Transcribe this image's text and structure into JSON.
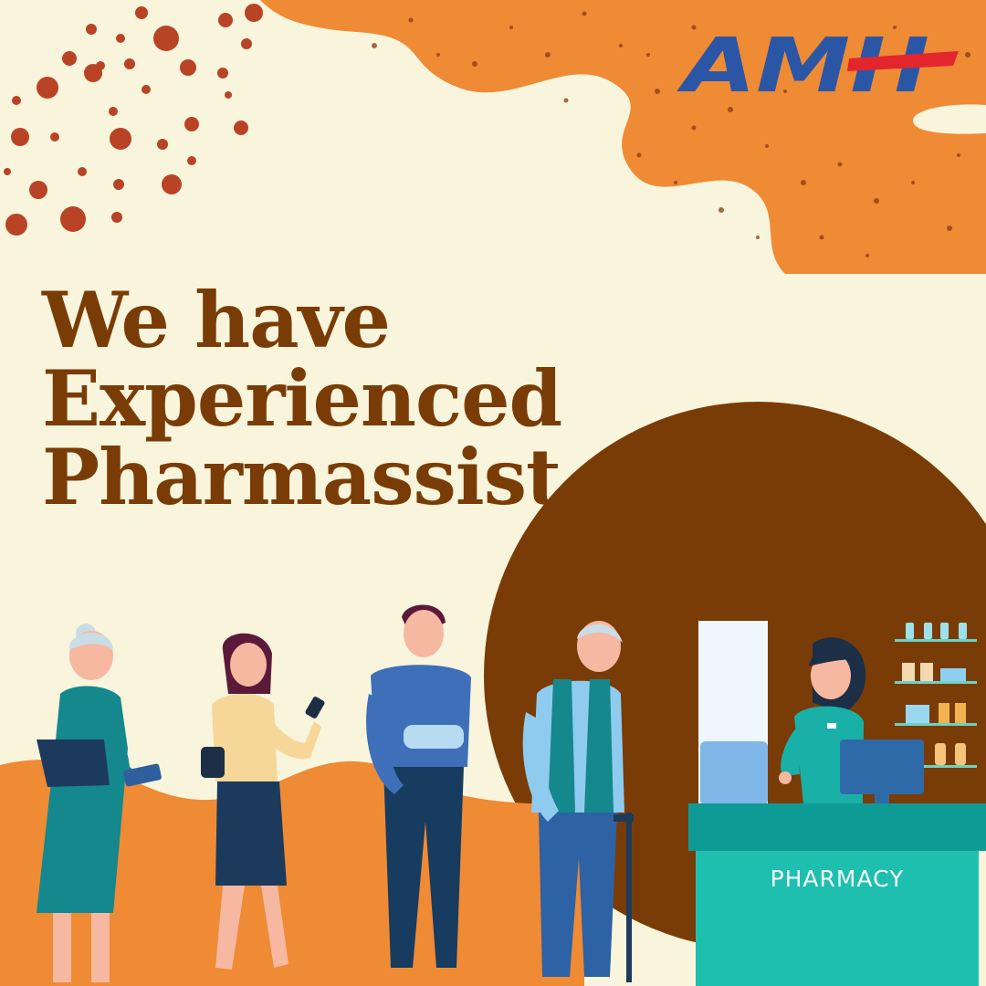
{
  "brand": {
    "logo_text": "AMH",
    "logo_color": "#2b56a6",
    "logo_cross_color": "#e3262d"
  },
  "headline": {
    "line1": "We have",
    "line2": "Experienced",
    "line3": "Pharmassist."
  },
  "counter": {
    "sign_label": "PHARMACY"
  },
  "colors": {
    "background": "#f8f5dc",
    "accent_orange": "#ef8a35",
    "headline_brown": "#7a3c06",
    "circle_brown": "#7a3c06",
    "dot_red": "#b94325",
    "counter_teal": "#1fbfb0",
    "counter_top_teal": "#0e9b96"
  },
  "illustration": {
    "scene": "people-queue-at-pharmacy-counter",
    "people": [
      "elderly-woman",
      "woman-with-phone",
      "man-with-arm-sling",
      "elderly-man-with-cane",
      "pharmacist"
    ]
  }
}
